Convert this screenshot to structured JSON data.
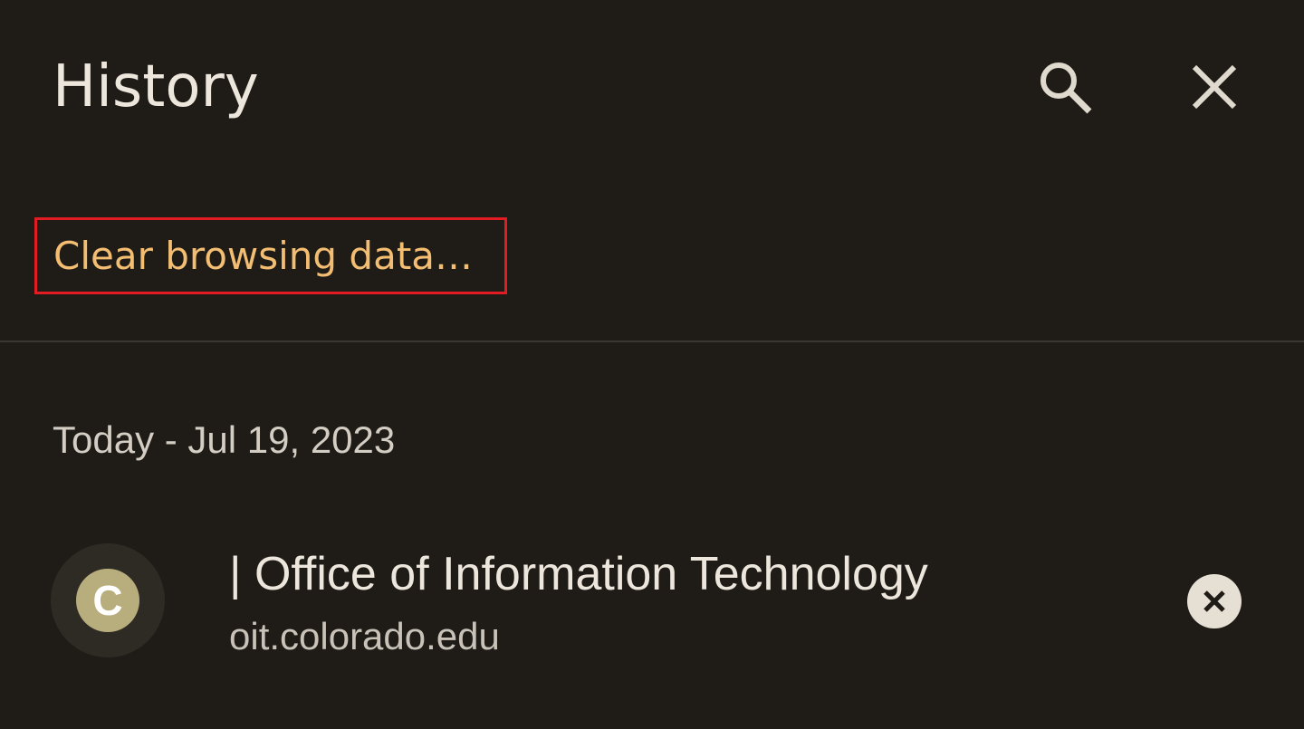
{
  "header": {
    "title": "History",
    "search_icon": "search-icon",
    "close_icon": "close-icon"
  },
  "actions": {
    "clear_browsing_data": "Clear browsing data…"
  },
  "history": {
    "groups": [
      {
        "date_label": "Today - Jul 19, 2023",
        "items": [
          {
            "favicon_letter": "C",
            "title": "| Office of Information Technology",
            "url": "oit.colorado.edu",
            "remove_icon": "remove-circle-icon"
          }
        ]
      }
    ]
  },
  "colors": {
    "background": "#1f1c18",
    "accent": "#f3bd72",
    "text_primary": "#ece6dc",
    "highlight_border": "#e31b23",
    "favicon_bg": "#b8ad7d"
  }
}
